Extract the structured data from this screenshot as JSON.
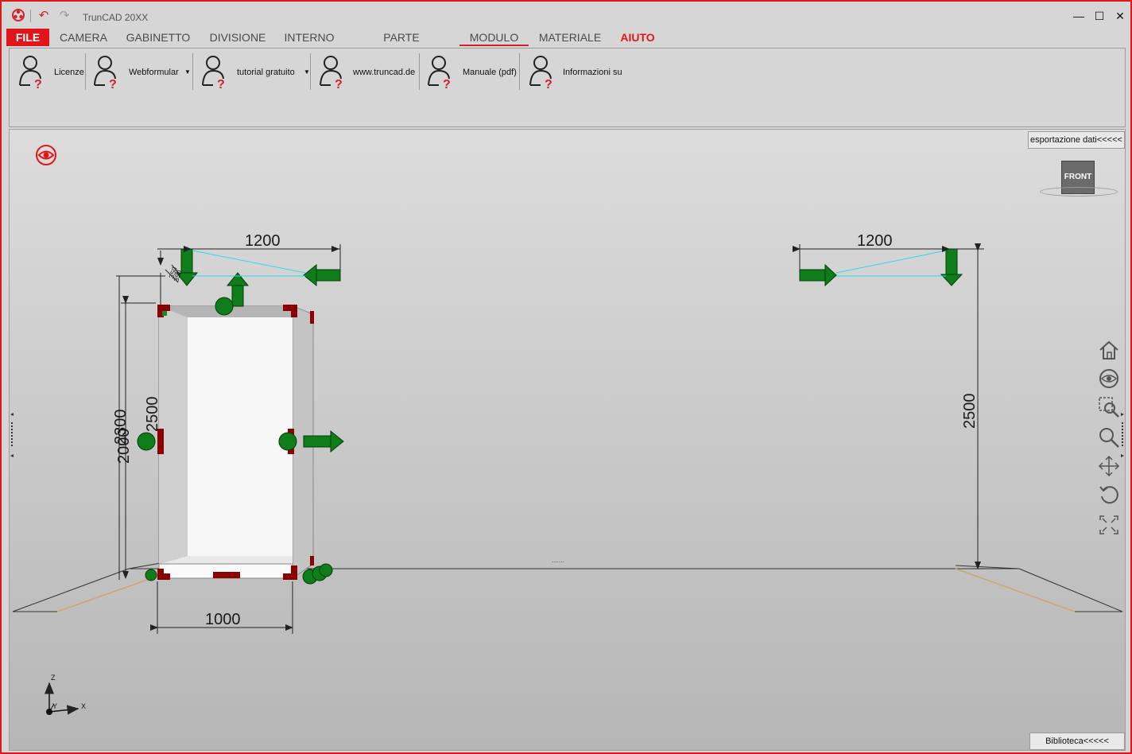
{
  "window": {
    "title": "TrunCAD 20XX",
    "buttons": {
      "minimize": "—",
      "maximize": "☐",
      "close": "✕"
    }
  },
  "menu": {
    "tabs": [
      {
        "label": "FILE",
        "style": "file"
      },
      {
        "label": "CAMERA"
      },
      {
        "label": "GABINETTO"
      },
      {
        "label": "DIVISIONE"
      },
      {
        "label": "INTERNO"
      },
      {
        "label": "PARTE ANTERIORE"
      },
      {
        "label": "MODULO",
        "active": true
      },
      {
        "label": "MATERIALE"
      },
      {
        "label": "AIUTO",
        "style": "help"
      }
    ]
  },
  "ribbon": {
    "buttons": [
      {
        "label": "Licenze",
        "icon": "user-help-icon"
      },
      {
        "label": "Webformular",
        "icon": "user-help-icon",
        "dropdown": true
      },
      {
        "label": "tutorial gratuito",
        "icon": "user-help-icon",
        "dropdown": true
      },
      {
        "label": "www.truncad.de",
        "icon": "user-help-icon"
      },
      {
        "label": "Manuale (pdf)",
        "icon": "user-help-icon"
      },
      {
        "label": "Informazioni su",
        "icon": "user-help-icon"
      }
    ]
  },
  "viewport": {
    "export_tab": "esportazione dati<<<<<",
    "library_tab": "Biblioteca<<<<<",
    "viewcube_label": "FRONT",
    "dimensions": {
      "left_width_top": "1200",
      "right_width_top": "1200",
      "left_height_inner": "2500",
      "left_height_outer_a": "2300",
      "left_height_outer_b": "2000",
      "right_height": "2500",
      "cabinet_width": "1000",
      "small_top_a": "350",
      "small_top_b": "350"
    },
    "axes": {
      "z": "Z",
      "y": "Y",
      "x": "X"
    },
    "nav_tools": [
      "home-icon",
      "orbit-eye-icon",
      "zoom-window-icon",
      "zoom-icon",
      "pan-icon",
      "rotate-icon",
      "fit-extents-icon"
    ],
    "colors": {
      "accent": "#e0161b",
      "arrow": "#0f7d1a",
      "marker": "#8b0000",
      "guide": "#2fd6e6"
    }
  }
}
